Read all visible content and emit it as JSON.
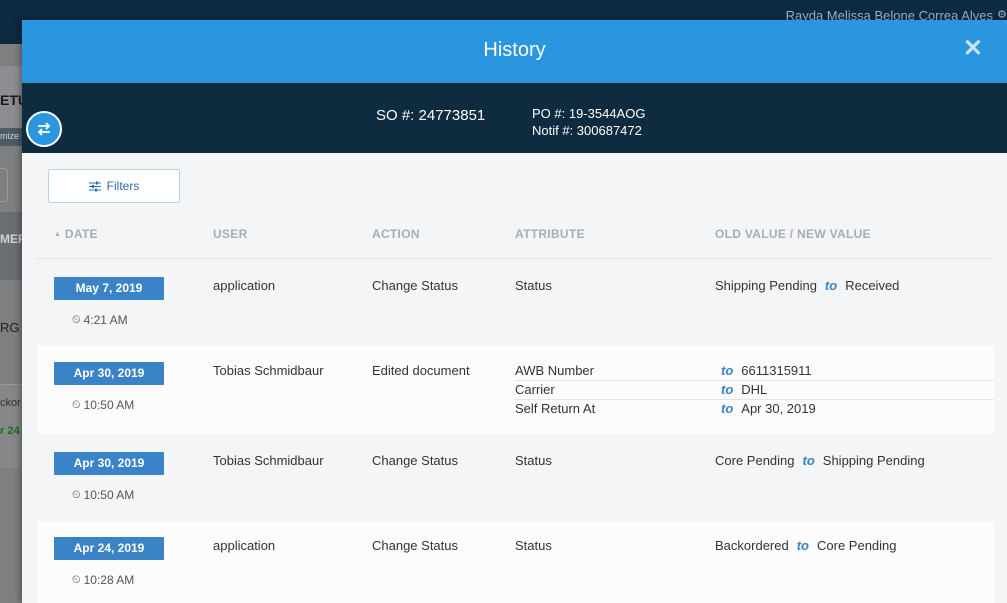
{
  "background": {
    "user_name": "Rayda Melissa Belone Correa Alves",
    "left_fragments": [
      "ETU",
      "mize",
      "MER",
      "RG",
      "ckor",
      "r 24"
    ]
  },
  "modal": {
    "title": "History",
    "close_label": "✕"
  },
  "info": {
    "so": "SO #: 24773851",
    "po": "PO #: 19-3544AOG",
    "notif": "Notif #: 300687472"
  },
  "filters_label": "Filters",
  "columns": {
    "date": "DATE",
    "user": "USER",
    "action": "ACTION",
    "attribute": "ATTRIBUTE",
    "values": "OLD VALUE / NEW VALUE"
  },
  "connector": "to",
  "rows": [
    {
      "date": "May 7, 2019",
      "time": "4:21 AM",
      "user": "application",
      "action": "Change Status",
      "changes": [
        {
          "attribute": "Status",
          "old": "Shipping Pending",
          "new": "Received"
        }
      ]
    },
    {
      "date": "Apr 30, 2019",
      "time": "10:50 AM",
      "user": "Tobias Schmidbaur",
      "action": "Edited document",
      "changes": [
        {
          "attribute": "AWB Number",
          "old": "",
          "new": "6611315911"
        },
        {
          "attribute": "Carrier",
          "old": "",
          "new": "DHL"
        },
        {
          "attribute": "Self Return At",
          "old": "",
          "new": "Apr 30, 2019"
        }
      ]
    },
    {
      "date": "Apr 30, 2019",
      "time": "10:50 AM",
      "user": "Tobias Schmidbaur",
      "action": "Change Status",
      "changes": [
        {
          "attribute": "Status",
          "old": "Core Pending",
          "new": "Shipping Pending"
        }
      ]
    },
    {
      "date": "Apr 24, 2019",
      "time": "10:28 AM",
      "user": "application",
      "action": "Change Status",
      "changes": [
        {
          "attribute": "Status",
          "old": "Backordered",
          "new": "Core Pending"
        }
      ]
    }
  ]
}
